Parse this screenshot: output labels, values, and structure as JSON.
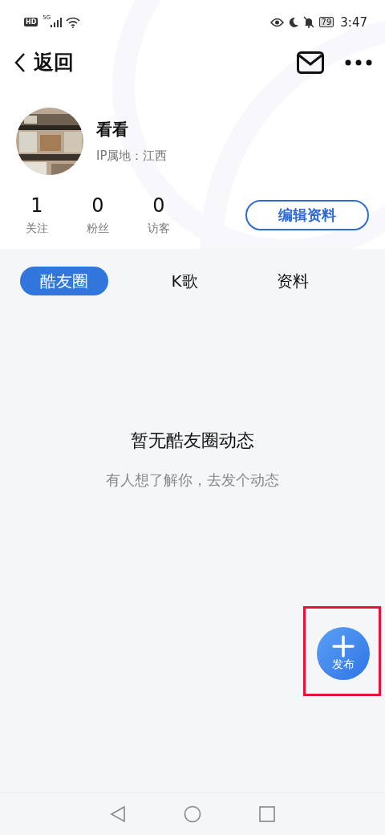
{
  "status_bar": {
    "hd": "HD",
    "network": "5G",
    "battery": "79",
    "time": "3:47"
  },
  "header": {
    "back_label": "返回"
  },
  "profile": {
    "name": "看看",
    "ip_location": "IP属地：江西"
  },
  "stats": [
    {
      "value": "1",
      "label": "关注"
    },
    {
      "value": "0",
      "label": "粉丝"
    },
    {
      "value": "0",
      "label": "访客"
    }
  ],
  "edit_button": "编辑资料",
  "tabs": [
    {
      "label": "酷友圈",
      "selected": true
    },
    {
      "label": "K歌",
      "selected": false
    },
    {
      "label": "资料",
      "selected": false
    }
  ],
  "empty_state": {
    "title": "暂无酷友圈动态",
    "subtitle": "有人想了解你，去发个动态"
  },
  "fab": {
    "label": "发布",
    "highlighted": true
  }
}
